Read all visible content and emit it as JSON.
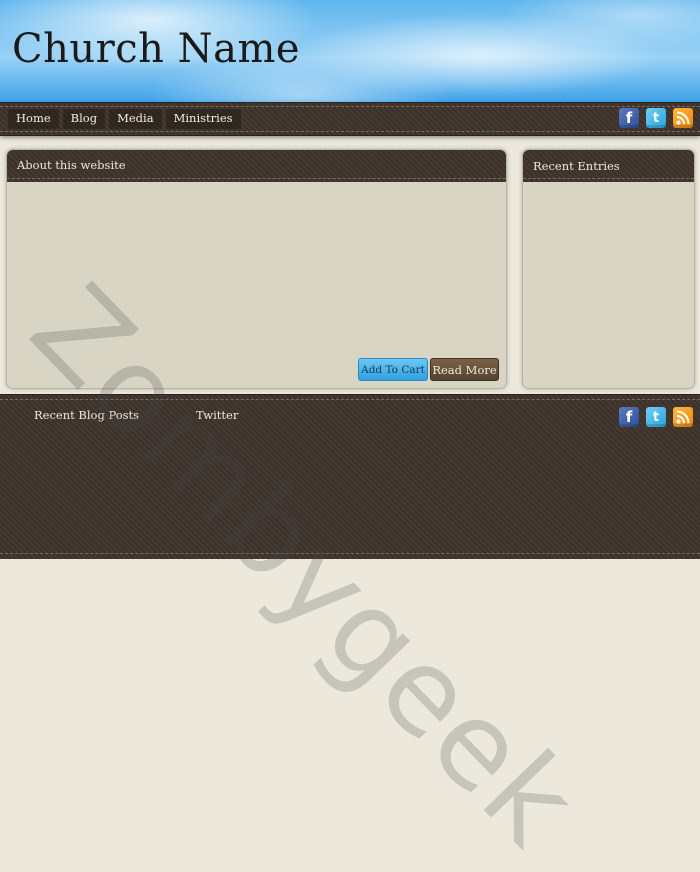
{
  "site": {
    "title": "Church Name"
  },
  "nav": {
    "items": [
      {
        "label": "Home"
      },
      {
        "label": "Blog"
      },
      {
        "label": "Media"
      },
      {
        "label": "Ministries"
      }
    ]
  },
  "social": {
    "facebook_glyph": "f",
    "twitter_glyph": "t",
    "icons": [
      "facebook-icon",
      "twitter-icon",
      "rss-icon"
    ]
  },
  "main_panel": {
    "title": "About this website",
    "add_to_cart_label": "Add To Cart",
    "read_more_label": "Read More"
  },
  "side_panel": {
    "title": "Recent Entries"
  },
  "footer": {
    "blog_heading": "Recent Blog Posts",
    "twitter_heading": "Twitter"
  },
  "watermark": {
    "text": "Zombygeek"
  },
  "colors": {
    "sky_blue": "#5fb6ee",
    "dark_brown": "#3e342c",
    "panel_beige": "#d8d5c5",
    "cart_blue": "#319fe0",
    "read_more_brown": "#55432f",
    "page_bg": "#ece8dc"
  }
}
